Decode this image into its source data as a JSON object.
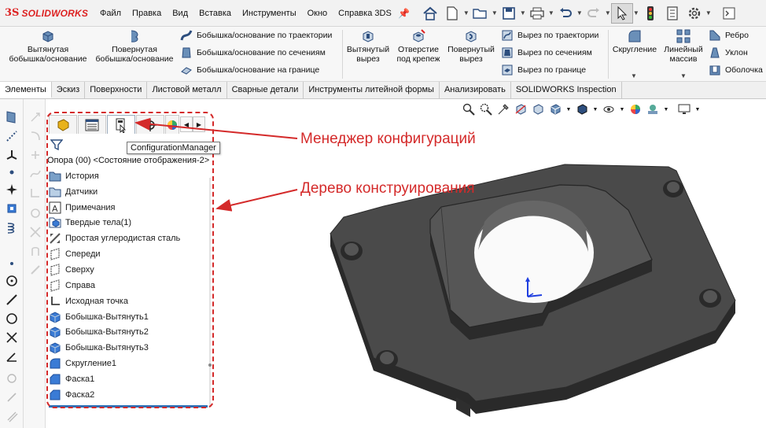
{
  "app": {
    "logo_prefix": "3S",
    "logo_text": "SOLIDWORKS"
  },
  "menu": [
    "Файл",
    "Правка",
    "Вид",
    "Вставка",
    "Инструменты",
    "Окно",
    "Справка 3DS"
  ],
  "quick_access_icons": [
    "home-icon",
    "new-document-icon",
    "open-icon",
    "save-icon",
    "print-icon",
    "undo-icon",
    "redo-icon",
    "select-icon",
    "traffic-light-icon",
    "file-properties-icon",
    "options-icon",
    "command-search-icon"
  ],
  "ribbon": {
    "extruded_boss": "Вытянутая\nбобышка/основание",
    "revolved_boss": "Повернутая\nбобышка/основание",
    "swept_boss": "Бобышка/основание по траектории",
    "lofted_boss": "Бобышка/основание по сечениям",
    "boundary_boss": "Бобышка/основание на границе",
    "extruded_cut": "Вытянутый\nвырез",
    "hole_wizard": "Отверстие\nпод крепеж",
    "revolved_cut": "Повернутый\nвырез",
    "swept_cut": "Вырез по траектории",
    "lofted_cut": "Вырез по сечениям",
    "boundary_cut": "Вырез по границе",
    "fillet": "Скругление",
    "linear_pattern": "Линейный\nмассив",
    "rib": "Ребро",
    "draft": "Уклон",
    "shell": "Оболочка"
  },
  "tabs": [
    "Элементы",
    "Эскиз",
    "Поверхности",
    "Листовой металл",
    "Сварные детали",
    "Инструменты литейной формы",
    "Анализировать",
    "SOLIDWORKS Inspection"
  ],
  "active_tab": "Элементы",
  "feature_manager": {
    "tooltip": "ConfigurationManager",
    "root": "Опора (00) <Состояние отображения-2>",
    "nodes": [
      {
        "label": "История",
        "icon": "history-folder-icon"
      },
      {
        "label": "Датчики",
        "icon": "sensors-icon"
      },
      {
        "label": "Примечания",
        "icon": "annotations-icon"
      },
      {
        "label": "Твердые тела(1)",
        "icon": "solid-bodies-icon"
      },
      {
        "label": "Простая углеродистая сталь",
        "icon": "material-icon"
      },
      {
        "label": "Спереди",
        "icon": "plane-icon"
      },
      {
        "label": "Сверху",
        "icon": "plane-icon"
      },
      {
        "label": "Справа",
        "icon": "plane-icon"
      },
      {
        "label": "Исходная точка",
        "icon": "origin-icon"
      },
      {
        "label": "Бобышка-Вытянуть1",
        "icon": "extrude-feature-icon"
      },
      {
        "label": "Бобышка-Вытянуть2",
        "icon": "extrude-feature-icon"
      },
      {
        "label": "Бобышка-Вытянуть3",
        "icon": "extrude-feature-icon"
      },
      {
        "label": "Скругление1",
        "icon": "fillet-feature-icon"
      },
      {
        "label": "Фаска1",
        "icon": "chamfer-feature-icon"
      },
      {
        "label": "Фаска2",
        "icon": "chamfer-feature-icon"
      }
    ]
  },
  "annotations": {
    "config_manager": "Менеджер конфигураций",
    "design_tree": "Дерево конструирования"
  },
  "colors": {
    "annotation_red": "#d42a2a",
    "part_dark": "#3a3a3a",
    "selection_blue": "#2f6fb5"
  }
}
